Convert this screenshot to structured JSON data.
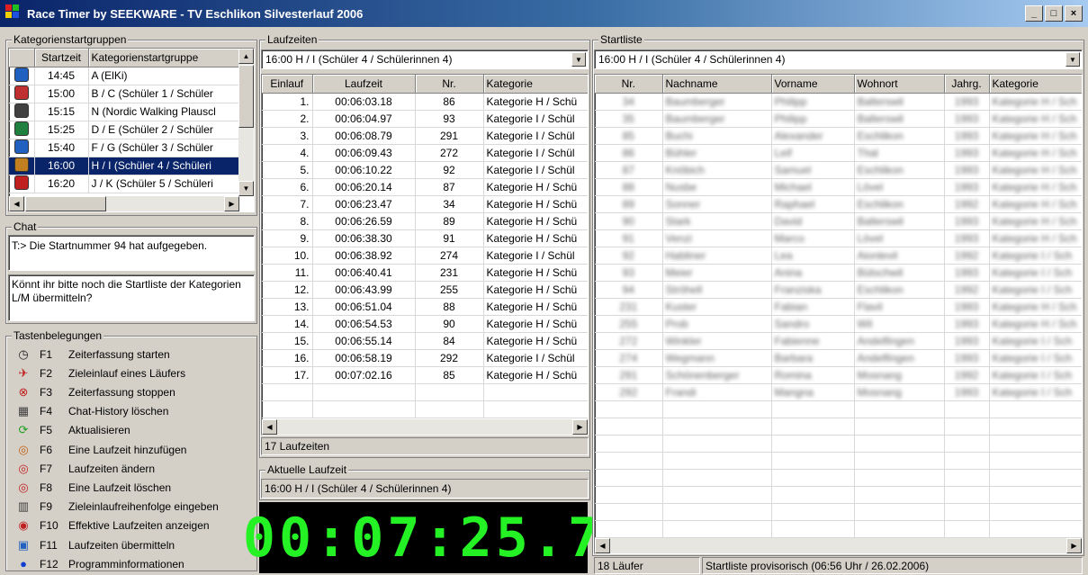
{
  "window": {
    "title": "Race Timer by SEEKWARE - TV Eschlikon Silvesterlauf 2006",
    "minimize": "_",
    "maximize": "□",
    "close": "×"
  },
  "groups": {
    "headers": [
      "Startzeit",
      "Kategorienstartgruppe"
    ],
    "title": "Kategorienstartgruppen",
    "rows": [
      {
        "time": "14:45",
        "group": "A (ElKi)",
        "color": "#2060c0"
      },
      {
        "time": "15:00",
        "group": "B / C (Schüler 1 / Schüler",
        "color": "#c03030"
      },
      {
        "time": "15:15",
        "group": "N (Nordic Walking Plauscl",
        "color": "#404040"
      },
      {
        "time": "15:25",
        "group": "D / E (Schüler 2 / Schüler",
        "color": "#208040"
      },
      {
        "time": "15:40",
        "group": "F / G (Schüler 3 / Schüler",
        "color": "#2060c0"
      },
      {
        "time": "16:00",
        "group": "H / I (Schüler 4 / Schüleri",
        "color": "#c08020"
      },
      {
        "time": "16:20",
        "group": "J / K (Schüler 5 / Schüleri",
        "color": "#c02020"
      }
    ]
  },
  "chat": {
    "title": "Chat",
    "history": "T:> Die Startnummer 94 hat aufgegeben.",
    "input": "Könnt ihr bitte noch die Startliste der Kategorien L/M übermitteln?"
  },
  "keys": {
    "title": "Tastenbelegungen",
    "items": [
      {
        "icon": "◷",
        "color": "#202020",
        "key": "F1",
        "label": "Zeiterfassung starten"
      },
      {
        "icon": "✈",
        "color": "#c02020",
        "key": "F2",
        "label": "Zieleinlauf eines Läufers"
      },
      {
        "icon": "⊗",
        "color": "#c02020",
        "key": "F3",
        "label": "Zeiterfassung stoppen"
      },
      {
        "icon": "▦",
        "color": "#404040",
        "key": "F4",
        "label": "Chat-History löschen"
      },
      {
        "icon": "⟳",
        "color": "#20a020",
        "key": "F5",
        "label": "Aktualisieren"
      },
      {
        "icon": "◎",
        "color": "#c06010",
        "key": "F6",
        "label": "Eine Laufzeit hinzufügen"
      },
      {
        "icon": "◎",
        "color": "#c02020",
        "key": "F7",
        "label": "Laufzeiten ändern"
      },
      {
        "icon": "◎",
        "color": "#c02020",
        "key": "F8",
        "label": "Eine Laufzeit löschen"
      },
      {
        "icon": "▥",
        "color": "#404040",
        "key": "F9",
        "label": "Zieleinlaufreihenfolge eingeben"
      },
      {
        "icon": "◉",
        "color": "#c02020",
        "key": "F10",
        "label": "Effektive Laufzeiten anzeigen"
      },
      {
        "icon": "▣",
        "color": "#2060c0",
        "key": "F11",
        "label": "Laufzeiten übermitteln"
      },
      {
        "icon": "●",
        "color": "#1040d0",
        "key": "F12",
        "label": "Programminformationen"
      }
    ]
  },
  "laufzeiten": {
    "title": "Laufzeiten",
    "selected": "16:00  H / I (Schüler 4 / Schülerinnen 4)",
    "headers": [
      "Einlauf",
      "Laufzeit",
      "Nr.",
      "Kategorie"
    ],
    "rows": [
      [
        "1.",
        "00:06:03.18",
        "86",
        "Kategorie H / Schü"
      ],
      [
        "2.",
        "00:06:04.97",
        "93",
        "Kategorie I / Schül"
      ],
      [
        "3.",
        "00:06:08.79",
        "291",
        "Kategorie I / Schül"
      ],
      [
        "4.",
        "00:06:09.43",
        "272",
        "Kategorie I / Schül"
      ],
      [
        "5.",
        "00:06:10.22",
        "92",
        "Kategorie I / Schül"
      ],
      [
        "6.",
        "00:06:20.14",
        "87",
        "Kategorie H / Schü"
      ],
      [
        "7.",
        "00:06:23.47",
        "34",
        "Kategorie H / Schü"
      ],
      [
        "8.",
        "00:06:26.59",
        "89",
        "Kategorie H / Schü"
      ],
      [
        "9.",
        "00:06:38.30",
        "91",
        "Kategorie H / Schü"
      ],
      [
        "10.",
        "00:06:38.92",
        "274",
        "Kategorie I / Schül"
      ],
      [
        "11.",
        "00:06:40.41",
        "231",
        "Kategorie H / Schü"
      ],
      [
        "12.",
        "00:06:43.99",
        "255",
        "Kategorie H / Schü"
      ],
      [
        "13.",
        "00:06:51.04",
        "88",
        "Kategorie H / Schü"
      ],
      [
        "14.",
        "00:06:54.53",
        "90",
        "Kategorie H / Schü"
      ],
      [
        "15.",
        "00:06:55.14",
        "84",
        "Kategorie H / Schü"
      ],
      [
        "16.",
        "00:06:58.19",
        "292",
        "Kategorie I / Schül"
      ],
      [
        "17.",
        "00:07:02.16",
        "85",
        "Kategorie H / Schü"
      ]
    ],
    "count": "17 Laufzeiten"
  },
  "aktuell": {
    "title": "Aktuelle Laufzeit",
    "group": "16:00  H / I (Schüler 4 / Schülerinnen 4)",
    "time": "00:07:25.7"
  },
  "startliste": {
    "title": "Startliste",
    "selected": "16:00  H / I (Schüler 4 / Schülerinnen 4)",
    "headers": [
      "Nr.",
      "Nachname",
      "Vorname",
      "Wohnort",
      "Jahrg.",
      "Kategorie"
    ],
    "rows": [
      [
        "34",
        "Baumberger",
        "Philipp",
        "Balterswil",
        "1993",
        "Kategorie H / Sch"
      ],
      [
        "35",
        "Baumberger",
        "Philipp",
        "Balterswil",
        "1993",
        "Kategorie H / Sch"
      ],
      [
        "85",
        "Buchi",
        "Alexander",
        "Eschlikon",
        "1993",
        "Kategorie H / Sch"
      ],
      [
        "86",
        "Bühler",
        "Leif",
        "Thal",
        "1993",
        "Kategorie H / Sch"
      ],
      [
        "87",
        "Knöbich",
        "Samuel",
        "Eschlikon",
        "1993",
        "Kategorie H / Sch"
      ],
      [
        "88",
        "Nusbe",
        "Michael",
        "Lövel",
        "1993",
        "Kategorie H / Sch"
      ],
      [
        "89",
        "Sonner",
        "Raphael",
        "Eschlikon",
        "1992",
        "Kategorie H / Sch"
      ],
      [
        "90",
        "Stark",
        "David",
        "Balterswil",
        "1993",
        "Kategorie H / Sch"
      ],
      [
        "91",
        "Venzi",
        "Marco",
        "Lövel",
        "1993",
        "Kategorie H / Sch"
      ],
      [
        "92",
        "Habliner",
        "Lea",
        "Aionlevil",
        "1992",
        "Kategorie I / Sch"
      ],
      [
        "93",
        "Meier",
        "Anina",
        "Bütschwil",
        "1993",
        "Kategorie I / Sch"
      ],
      [
        "94",
        "Ströhell",
        "Franziska",
        "Eschlikon",
        "1992",
        "Kategorie I / Sch"
      ],
      [
        "231",
        "Kuster",
        "Fabian",
        "Flavil",
        "1993",
        "Kategorie H / Sch"
      ],
      [
        "255",
        "Prob",
        "Sandro",
        "Wil",
        "1993",
        "Kategorie H / Sch"
      ],
      [
        "272",
        "Winkler",
        "Fabienne",
        "Andelfingen",
        "1993",
        "Kategorie I / Sch"
      ],
      [
        "274",
        "Wegmann",
        "Barbara",
        "Andelfingen",
        "1993",
        "Kategorie I / Sch"
      ],
      [
        "291",
        "Schönenberger",
        "Romina",
        "Mosnang",
        "1992",
        "Kategorie I / Sch"
      ],
      [
        "292",
        "Frandi",
        "Mangna",
        "Mosnang",
        "1993",
        "Kategorie I / Sch"
      ]
    ],
    "count": "18 Läufer",
    "status": "Startliste provisorisch (06:56 Uhr / 26.02.2006)"
  }
}
